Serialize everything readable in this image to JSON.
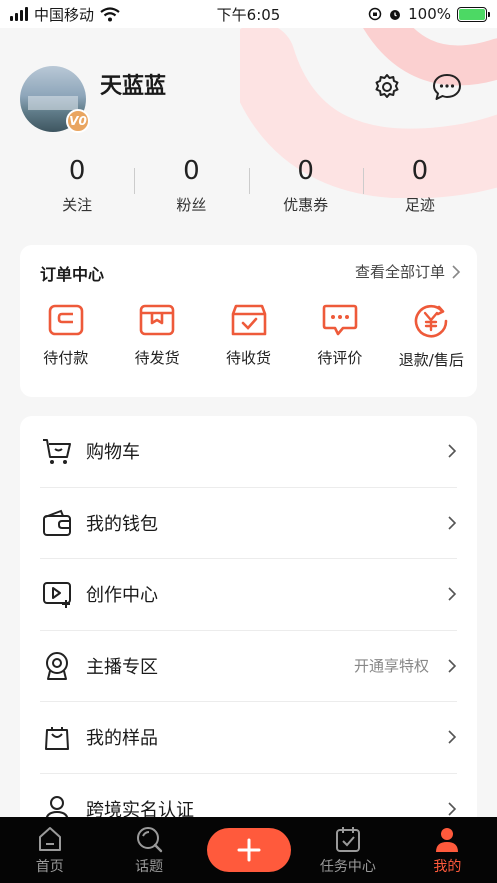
{
  "status_bar": {
    "carrier": "中国移动",
    "time": "下午6:05",
    "battery": "100%",
    "battery_level": 1.0
  },
  "profile": {
    "username": "天蓝蓝",
    "badge": "V0",
    "settings_icon": "gear-icon",
    "messages_icon": "chat-bubble-icon"
  },
  "stats": [
    {
      "value": "0",
      "label": "关注"
    },
    {
      "value": "0",
      "label": "粉丝"
    },
    {
      "value": "0",
      "label": "优惠券"
    },
    {
      "value": "0",
      "label": "足迹"
    }
  ],
  "orders": {
    "title": "订单中心",
    "view_all": "查看全部订单",
    "items": [
      {
        "label": "待付款",
        "icon": "wallet-card-icon"
      },
      {
        "label": "待发货",
        "icon": "shipping-box-icon"
      },
      {
        "label": "待收货",
        "icon": "receive-box-icon"
      },
      {
        "label": "待评价",
        "icon": "comment-icon"
      },
      {
        "label": "退款/售后",
        "icon": "refund-yen-icon"
      }
    ]
  },
  "menu": [
    {
      "label": "购物车",
      "icon": "cart-icon",
      "extra": ""
    },
    {
      "label": "我的钱包",
      "icon": "wallet-icon",
      "extra": ""
    },
    {
      "label": "创作中心",
      "icon": "video-create-icon",
      "extra": ""
    },
    {
      "label": "主播专区",
      "icon": "streamer-camera-icon",
      "extra": "开通享特权"
    },
    {
      "label": "我的样品",
      "icon": "sample-bag-icon",
      "extra": ""
    },
    {
      "label": "跨境实名认证",
      "icon": "person-verify-icon",
      "extra": ""
    }
  ],
  "tabbar": {
    "items": [
      {
        "label": "首页",
        "icon": "home-icon"
      },
      {
        "label": "话题",
        "icon": "search-topic-icon"
      },
      {
        "label": "",
        "icon": "plus-icon"
      },
      {
        "label": "任务中心",
        "icon": "task-calendar-icon"
      },
      {
        "label": "我的",
        "icon": "profile-icon"
      }
    ],
    "active_index": 4
  },
  "colors": {
    "accent": "#ff5a3c",
    "tabbar_bg": "#050505",
    "page_bg": "#f6f6f6",
    "badge": "#e9a560"
  }
}
